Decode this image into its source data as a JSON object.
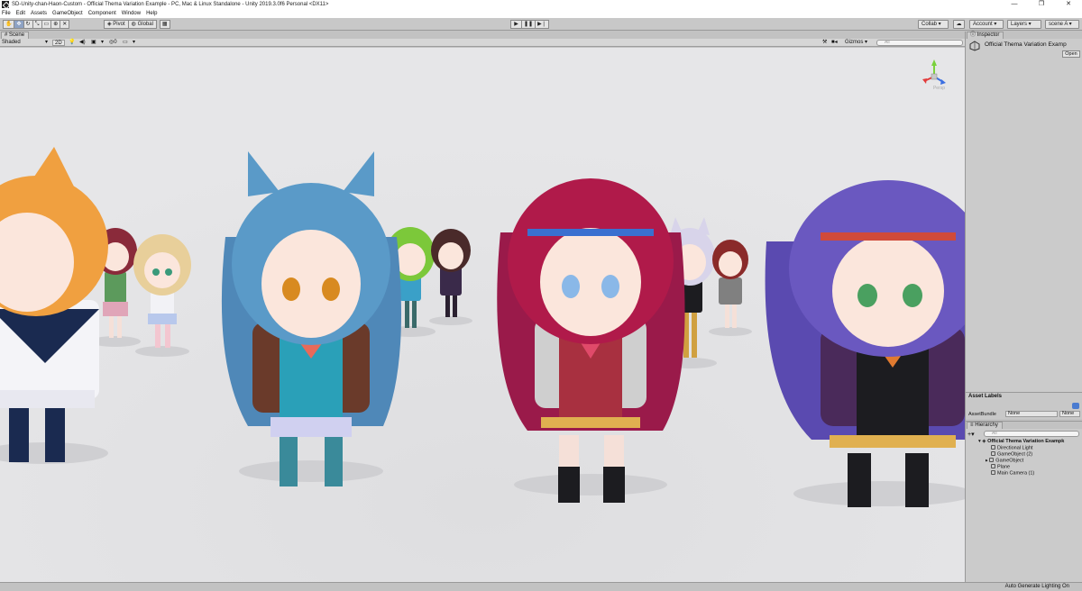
{
  "window": {
    "title": "SD-Unity-chan-Haon-Custom - Official Thema Variation Example - PC, Mac & Linux Standalone - Unity 2019.3.0f6 Personal <DX11>",
    "minimize": "—",
    "restore": "❐",
    "close": "✕"
  },
  "menu": [
    "File",
    "Edit",
    "Assets",
    "GameObject",
    "Component",
    "Window",
    "Help"
  ],
  "toolbar": {
    "pivot": "Pivot",
    "global": "Global",
    "collab": "Collab ▾",
    "account": "Account ▾",
    "layers": "Layers ▾",
    "layout": "scene A ▾"
  },
  "scene": {
    "tab_label": "Scene",
    "shading": "Shaded",
    "mode_2d": "2D",
    "gizmos": "Gizmos ▾",
    "search_placeholder": "All",
    "hidden_count": "0",
    "gizmo_label": "Persp"
  },
  "inspector": {
    "tab_label": "Inspector",
    "object_title": "Official Thema Variation Examp",
    "open_button": "Open"
  },
  "asset_labels": {
    "title": "Asset Labels",
    "bundle_label": "AssetBundle",
    "bundle_value": "None",
    "variant_value": "None"
  },
  "hierarchy": {
    "tab_label": "Hierarchy",
    "search_placeholder": "All",
    "scene_name": "Official Thema Variation Exampk",
    "items": [
      "Directional Light",
      "GameObject (2)",
      "GameObject",
      "Plane",
      "Main Camera (1)"
    ]
  },
  "status": {
    "text": "Auto Generate Lighting On"
  },
  "colors": {
    "editor_bg": "#c2c2c2",
    "viewport_bg": "#e4e4e6",
    "active_tool": "#8da2c4",
    "axis_x": "#e23b3b",
    "axis_y": "#7ad13c",
    "axis_z": "#3b6fe2"
  }
}
